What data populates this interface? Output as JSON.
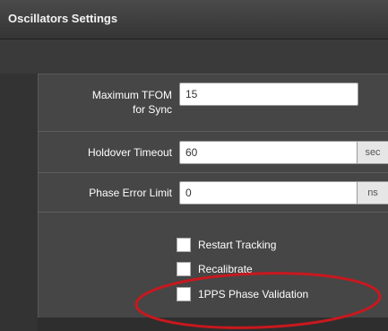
{
  "window": {
    "title": "Oscillators Settings"
  },
  "fields": {
    "tfom": {
      "label_line1": "Maximum TFOM",
      "label_line2": "for Sync",
      "value": "15"
    },
    "holdover": {
      "label": "Holdover Timeout",
      "value": "60",
      "unit": "sec"
    },
    "phase_error": {
      "label": "Phase Error Limit",
      "value": "0",
      "unit": "ns"
    }
  },
  "checkboxes": {
    "restart_tracking": "Restart Tracking",
    "recalibrate": "Recalibrate",
    "pps_validation": "1PPS Phase Validation"
  },
  "colors": {
    "annotation": "#c8181e"
  }
}
